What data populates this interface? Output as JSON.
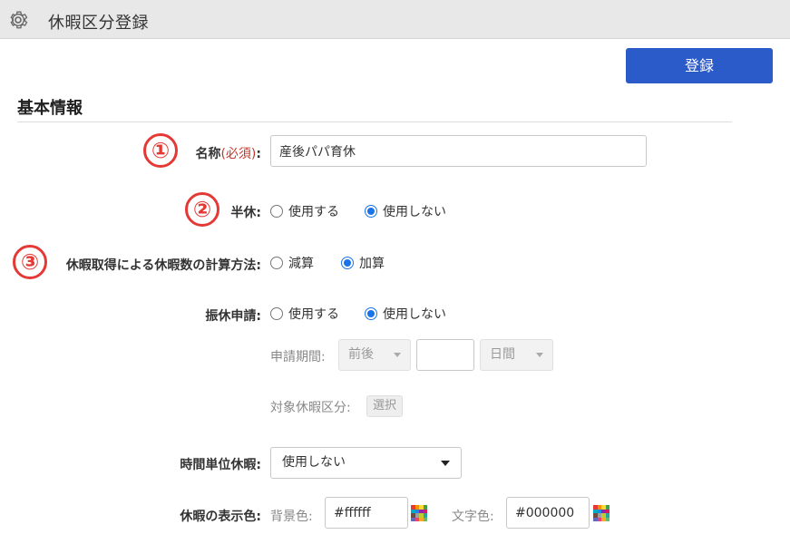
{
  "header": {
    "title": "休暇区分登録",
    "icon": "gear-icon"
  },
  "toolbar": {
    "register_label": "登録",
    "register_color": "#2b5bc9"
  },
  "section": {
    "title": "基本情報"
  },
  "badges": [
    "①",
    "②",
    "③"
  ],
  "form": {
    "name": {
      "label": "名称",
      "required": "(必須)",
      "colon": ":",
      "value": "産後パパ育休"
    },
    "half_day": {
      "label": "半休:",
      "options": [
        {
          "label": "使用する",
          "checked": false
        },
        {
          "label": "使用しない",
          "checked": true
        }
      ]
    },
    "calc_method": {
      "label": "休暇取得による休暇数の計算方法:",
      "options": [
        {
          "label": "減算",
          "checked": false
        },
        {
          "label": "加算",
          "checked": true
        }
      ]
    },
    "substitute": {
      "label": "振休申請:",
      "options": [
        {
          "label": "使用する",
          "checked": false
        },
        {
          "label": "使用しない",
          "checked": true
        }
      ],
      "period_label": "申請期間:",
      "period_direction": "前後",
      "period_value": "",
      "period_unit": "日間",
      "target_label": "対象休暇区分:",
      "target_button": "選択"
    },
    "hourly": {
      "label": "時間単位休暇:",
      "value": "使用しない"
    },
    "display_color": {
      "label": "休暇の表示色:",
      "bg_label": "背景色:",
      "bg_value": "#ffffff",
      "text_label": "文字色:",
      "text_value": "#000000"
    }
  },
  "colors": {
    "accent": "#2b5bc9",
    "badge": "#e53935",
    "radio": "#1a73e8",
    "required": "#c0392b"
  }
}
